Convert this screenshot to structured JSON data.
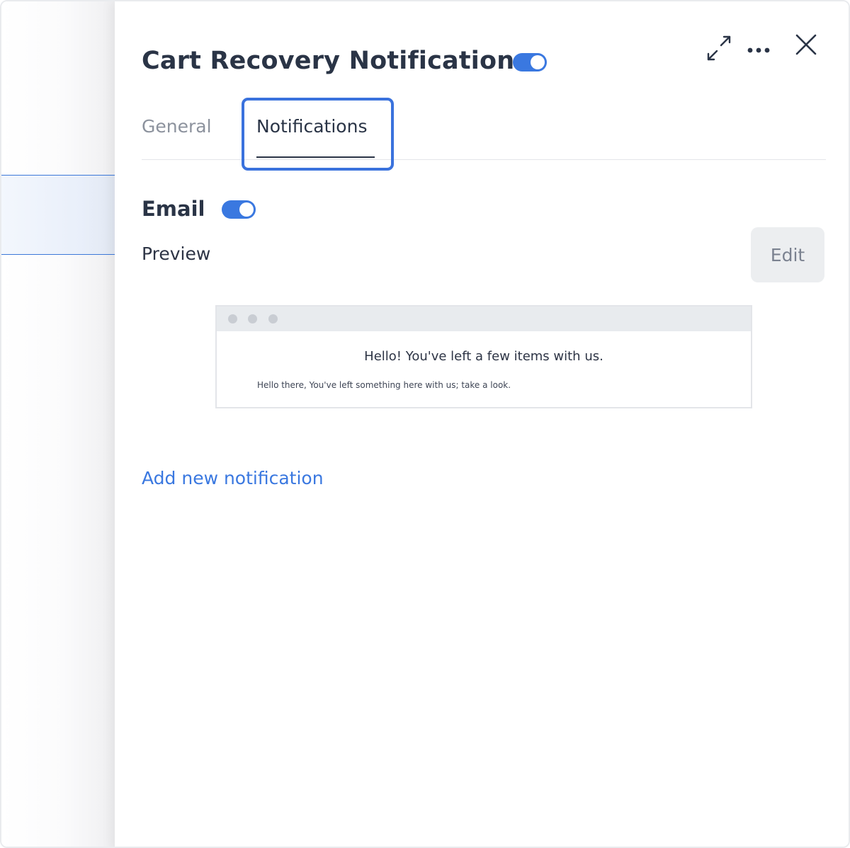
{
  "colors": {
    "accent": "#3a78e0",
    "title_text": "#2a3446",
    "muted_text": "#8c929d",
    "focus_outline": "#3a72dd"
  },
  "header": {
    "title": "Cart Recovery Notification",
    "enabled": true,
    "icons": [
      "expand-icon",
      "more-icon",
      "close-icon"
    ]
  },
  "tabs": [
    {
      "label": "General",
      "active": false
    },
    {
      "label": "Notifications",
      "active": true
    }
  ],
  "email": {
    "title": "Email",
    "enabled": true,
    "preview_label": "Preview",
    "edit_label": "Edit",
    "preview": {
      "heading": "Hello! You've left a few items with us.",
      "body": "Hello there, You've left something here with us; take a look."
    }
  },
  "add_notification_label": "Add new notification"
}
